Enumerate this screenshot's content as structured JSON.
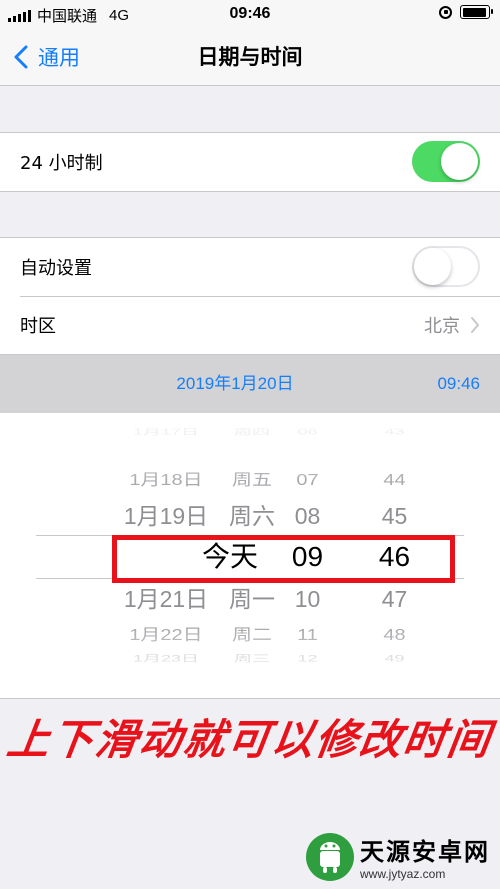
{
  "status_bar": {
    "carrier": "中国联通",
    "network": "4G",
    "time": "09:46",
    "battery_level": 0.95
  },
  "nav": {
    "back_label": "通用",
    "title": "日期与时间"
  },
  "settings": {
    "hour24": {
      "label": "24 小时制",
      "enabled": true
    },
    "auto_set": {
      "label": "自动设置",
      "enabled": false
    },
    "timezone": {
      "label": "时区",
      "value": "北京"
    }
  },
  "date_bar": {
    "date": "2019年1月20日",
    "time": "09:46"
  },
  "picker": {
    "rows": [
      {
        "date": "1月17日",
        "weekday": "周四",
        "hour": "06",
        "minute": "43"
      },
      {
        "date": "1月18日",
        "weekday": "周五",
        "hour": "07",
        "minute": "44"
      },
      {
        "date": "1月19日",
        "weekday": "周六",
        "hour": "08",
        "minute": "45"
      },
      {
        "today": "今天",
        "hour": "09",
        "minute": "46"
      },
      {
        "date": "1月21日",
        "weekday": "周一",
        "hour": "10",
        "minute": "47"
      },
      {
        "date": "1月22日",
        "weekday": "周二",
        "hour": "11",
        "minute": "48"
      },
      {
        "date": "1月23日",
        "weekday": "周三",
        "hour": "12",
        "minute": "49"
      }
    ]
  },
  "instruction": "上下滑动就可以修改时间",
  "watermark": {
    "title": "天源安卓网",
    "url": "www.jytyaz.com"
  },
  "colors": {
    "accent": "#157efb",
    "toggle_on": "#4cd964",
    "annotation_red": "#e8121b"
  }
}
